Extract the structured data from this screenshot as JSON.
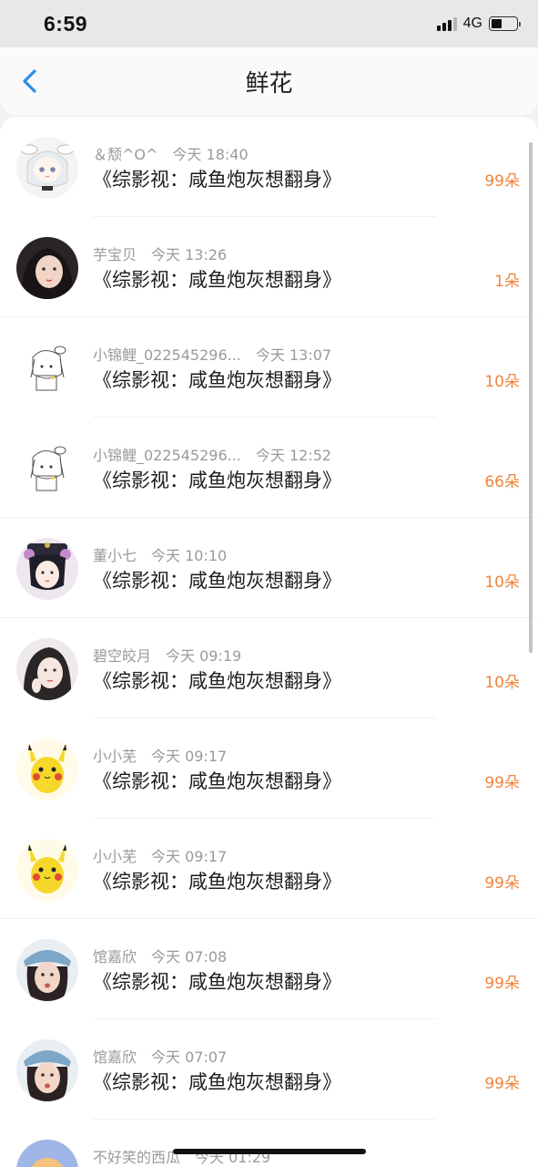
{
  "status_bar": {
    "time": "6:59",
    "network": "4G"
  },
  "header": {
    "title": "鲜花"
  },
  "colors": {
    "accent_back": "#2a8ee8",
    "flower_count": "#f0843c"
  },
  "rows": [
    {
      "username": "＆颓^O^",
      "time": "今天 18:40",
      "book_title": "《综影视：咸鱼炮灰想翻身》",
      "count": "99朵",
      "avatar_icon": "anime-girl-cow-hat-icon"
    },
    {
      "username": "芋宝贝",
      "time": "今天 13:26",
      "book_title": "《综影视：咸鱼炮灰想翻身》",
      "count": "1朵",
      "avatar_icon": "girl-photo-icon"
    },
    {
      "username": "小锦鲤_022545296...",
      "time": "今天 13:07",
      "book_title": "《综影视：咸鱼炮灰想翻身》",
      "count": "10朵",
      "avatar_icon": "sketch-girl-icon"
    },
    {
      "username": "小锦鲤_022545296...",
      "time": "今天 12:52",
      "book_title": "《综影视：咸鱼炮灰想翻身》",
      "count": "66朵",
      "avatar_icon": "sketch-girl-icon"
    },
    {
      "username": "董小七",
      "time": "今天 10:10",
      "book_title": "《综影视：咸鱼炮灰想翻身》",
      "count": "10朵",
      "avatar_icon": "qing-princess-icon"
    },
    {
      "username": "碧空皎月",
      "time": "今天 09:19",
      "book_title": "《综影视：咸鱼炮灰想翻身》",
      "count": "10朵",
      "avatar_icon": "girl-drawing-icon"
    },
    {
      "username": "小小芜",
      "time": "今天 09:17",
      "book_title": "《综影视：咸鱼炮灰想翻身》",
      "count": "99朵",
      "avatar_icon": "pikachu-icon"
    },
    {
      "username": "小小芜",
      "time": "今天 09:17",
      "book_title": "《综影视：咸鱼炮灰想翻身》",
      "count": "99朵",
      "avatar_icon": "pikachu-icon"
    },
    {
      "username": "馆嘉欣",
      "time": "今天 07:08",
      "book_title": "《综影视：咸鱼炮灰想翻身》",
      "count": "99朵",
      "avatar_icon": "girl-hat-photo-icon"
    },
    {
      "username": "馆嘉欣",
      "time": "今天 07:07",
      "book_title": "《综影视：咸鱼炮灰想翻身》",
      "count": "99朵",
      "avatar_icon": "girl-hat-photo-icon"
    },
    {
      "username": "不好笑的西瓜",
      "time": "今天 01:29",
      "book_title": "",
      "count": "",
      "avatar_icon": "cartoon-icon"
    }
  ]
}
